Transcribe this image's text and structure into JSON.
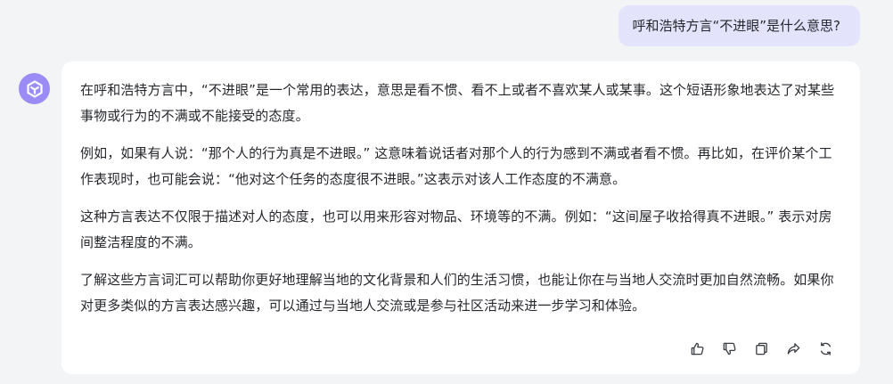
{
  "user_message": {
    "text": "呼和浩特方言“不进眼”是什么意思?"
  },
  "assistant": {
    "avatar_icon": "assistant-logo-icon",
    "paragraphs": [
      "在呼和浩特方言中，“不进眼”是一个常用的表达，意思是看不惯、看不上或者不喜欢某人或某事。这个短语形象地表达了对某些事物或行为的不满或不能接受的态度。",
      "例如，如果有人说：“那个人的行为真是不进眼。” 这意味着说话者对那个人的行为感到不满或者看不惯。再比如，在评价某个工作表现时，也可能会说：“他对这个任务的态度很不进眼。”这表示对该人工作态度的不满意。",
      "这种方言表达不仅限于描述对人的态度，也可以用来形容对物品、环境等的不满。例如：“这间屋子收拾得真不进眼。” 表示对房间整洁程度的不满。",
      "了解这些方言词汇可以帮助你更好地理解当地的文化背景和人们的生活习惯，也能让你在与当地人交流时更加自然流畅。如果你对更多类似的方言表达感兴趣，可以通过与当地人交流或是参与社区活动来进一步学习和体验。"
    ]
  },
  "actions": {
    "items": [
      "thumbs-up-icon",
      "thumbs-down-icon",
      "copy-icon",
      "share-icon",
      "regenerate-icon"
    ]
  },
  "colors": {
    "background": "#f3f4f6",
    "user_bubble": "#e3e3fb",
    "avatar": "#9a8cf4",
    "card": "#ffffff",
    "text": "#26282d",
    "icon": "#3a3d44"
  }
}
